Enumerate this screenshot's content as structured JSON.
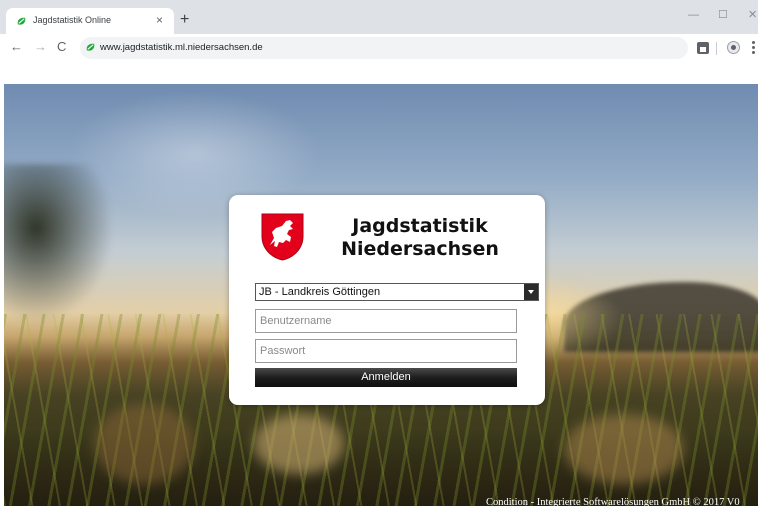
{
  "browser": {
    "tab": {
      "title": "Jagdstatistik Online",
      "close": "×"
    },
    "new_tab": "+",
    "window": {
      "minimize": "—",
      "maximize": "☐",
      "close": "✕"
    },
    "nav": {
      "back": "←",
      "forward": "→",
      "reload": "C"
    },
    "url": "www.jagdstatistik.ml.niedersachsen.de",
    "favicon_color": "#22a83a"
  },
  "login": {
    "title_line1": "Jagdstatistik",
    "title_line2": "Niedersachsen",
    "district_select": {
      "value": "JB - Landkreis Göttingen"
    },
    "username": {
      "placeholder": "Benutzername",
      "value": ""
    },
    "password": {
      "placeholder": "Passwort",
      "value": ""
    },
    "submit_label": "Anmelden",
    "crest_color": "#e2001a"
  },
  "footer": {
    "text": "Condition - Integrierte Softwarelösungen GmbH © 2017 V0"
  }
}
